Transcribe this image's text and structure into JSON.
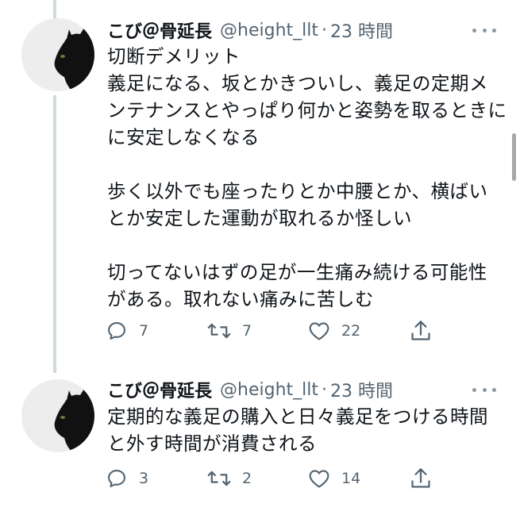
{
  "tweets": [
    {
      "author_name": "こび＠骨延長",
      "handle": "@height_llt",
      "separator": "·",
      "time": "23 時間",
      "avatar_icon": "black-cat-avatar",
      "text_paragraphs": [
        [
          "切断デメリット",
          "義足になる、坂とかきついし、義足の定期メ",
          "ンテナンスとやっぱり何かと姿勢を取るときに",
          "に安定しなくなる"
        ],
        [
          "歩く以外でも座ったりとか中腰とか、横ばい",
          "とか安定した運動が取れるか怪しい"
        ],
        [
          "切ってないはずの足が一生痛み続ける可能性",
          "がある。取れない痛みに苦しむ"
        ]
      ],
      "actions": {
        "reply_count": "7",
        "retweet_count": "7",
        "like_count": "22"
      }
    },
    {
      "author_name": "こび＠骨延長",
      "handle": "@height_llt",
      "separator": "·",
      "time": "23 時間",
      "avatar_icon": "black-cat-avatar",
      "text_paragraphs": [
        [
          "定期的な義足の購入と日々義足をつける時間",
          "と外す時間が消費される"
        ]
      ],
      "actions": {
        "reply_count": "3",
        "retweet_count": "2",
        "like_count": "14"
      }
    }
  ],
  "colors": {
    "text": "#0f1419",
    "secondary": "#536471",
    "thread_line": "#cfd9de"
  },
  "icons": [
    "reply-icon",
    "retweet-icon",
    "like-icon",
    "share-icon",
    "more-icon"
  ]
}
